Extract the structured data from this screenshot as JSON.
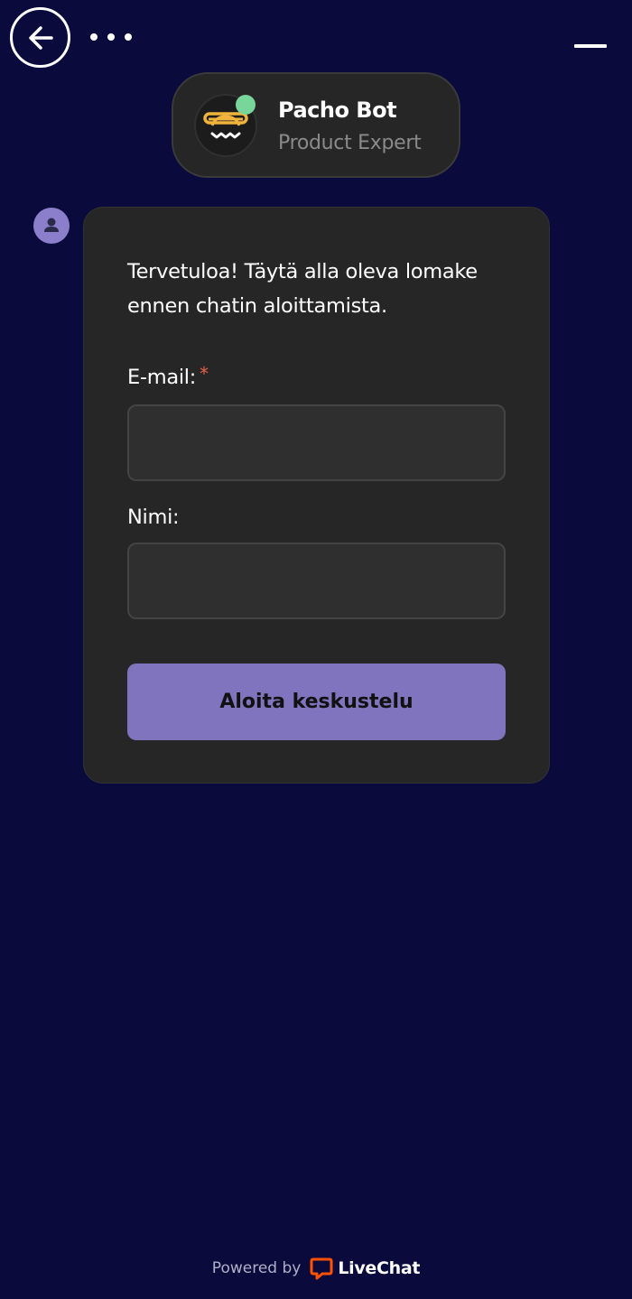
{
  "header": {
    "back_icon": "arrow-left-icon",
    "more_icon": "more-horizontal-icon",
    "minimize_icon": "minimize-icon"
  },
  "agent": {
    "name": "Pacho Bot",
    "role": "Product Expert",
    "status_color": "#78d69a"
  },
  "form": {
    "welcome": "Tervetuloa! Täytä alla oleva lomake ennen chatin aloittamista.",
    "email_label": "E-mail:",
    "required_mark": "*",
    "email_value": "",
    "name_label": "Nimi:",
    "name_value": "",
    "submit_label": "Aloita keskustelu"
  },
  "footer": {
    "powered_by": "Powered by",
    "brand": "LiveChat",
    "brand_color": "#ff5100"
  },
  "colors": {
    "background": "#0a0a3c",
    "card": "#262626",
    "accent": "#7f74bd"
  }
}
